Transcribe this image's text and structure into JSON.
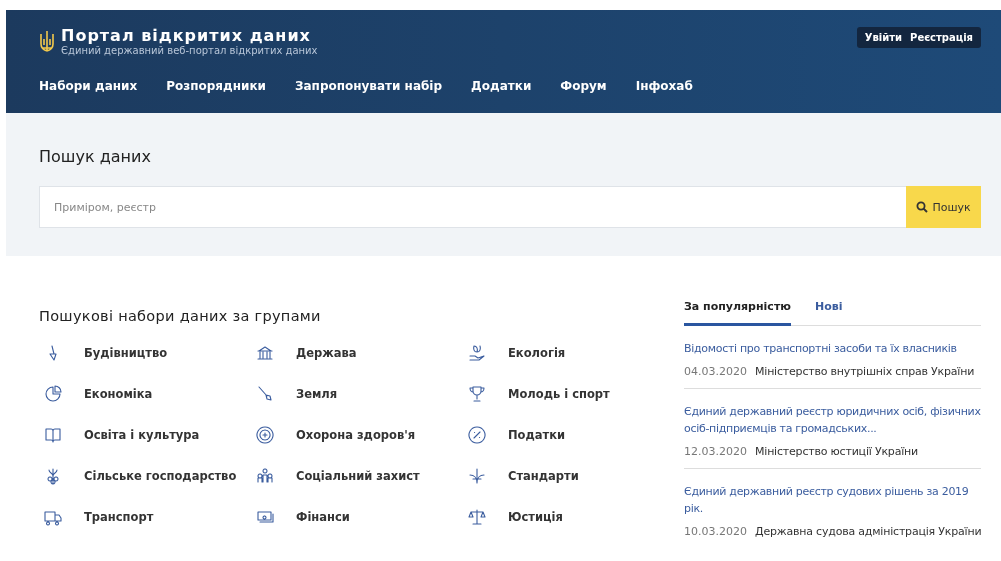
{
  "header": {
    "title": "Портал відкритих даних",
    "subtitle": "Єдиний державний веб-портал відкритих даних",
    "auth": [
      "Увійти",
      "Реєстрація"
    ],
    "nav": [
      "Набори даних",
      "Розпорядники",
      "Запропонувати набір",
      "Додатки",
      "Форум",
      "Інфохаб"
    ]
  },
  "search": {
    "heading": "Пошук даних",
    "placeholder": "Приміром, реєстр",
    "button": "Пошук"
  },
  "groups": {
    "heading": "Пошукові набори даних за групами",
    "items": [
      "Будівництво",
      "Держава",
      "Екологія",
      "Економіка",
      "Земля",
      "Молодь і спорт",
      "Освіта і культура",
      "Охорона здоров'я",
      "Податки",
      "Сільське господарство",
      "Соціальний захист",
      "Стандарти",
      "Транспорт",
      "Фінанси",
      "Юстиція"
    ]
  },
  "datasets": {
    "tabs": [
      {
        "label": "За популярністю",
        "selected": true
      },
      {
        "label": "Нові",
        "selected": false
      }
    ],
    "items": [
      {
        "title": "Відомості про транспортні засоби та їх власників",
        "date": "04.03.2020",
        "publisher": "Міністерство внутрішніх справ України"
      },
      {
        "title": "Єдиний державний реєстр юридичних осіб, фізичних осіб-підприємців та громадських...",
        "date": "12.03.2020",
        "publisher": "Міністерство юстиції України"
      },
      {
        "title": "Єдиний державний реєстр судових рішень за 2019 рік.",
        "date": "10.03.2020",
        "publisher": "Державна судова адміністрація України"
      }
    ]
  }
}
